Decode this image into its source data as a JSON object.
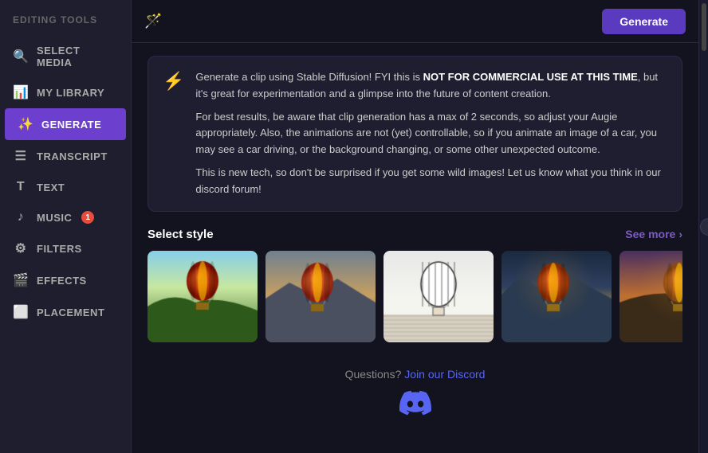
{
  "sidebar": {
    "title": "EDITING TOOLS",
    "items": [
      {
        "id": "select-media",
        "label": "SELECT MEDIA",
        "icon": "🔍",
        "active": false,
        "badge": null
      },
      {
        "id": "my-library",
        "label": "MY LIBRARY",
        "icon": "📊",
        "active": false,
        "badge": null
      },
      {
        "id": "generate",
        "label": "GENERATE",
        "icon": "✨",
        "active": true,
        "badge": null
      },
      {
        "id": "transcript",
        "label": "TRANSCRIPT",
        "icon": "☰",
        "active": false,
        "badge": null
      },
      {
        "id": "text",
        "label": "TEXT",
        "icon": "T",
        "active": false,
        "badge": null
      },
      {
        "id": "music",
        "label": "MUSIC",
        "icon": "♪",
        "active": false,
        "badge": "1"
      },
      {
        "id": "filters",
        "label": "FILTERS",
        "icon": "⚙",
        "active": false,
        "badge": null
      },
      {
        "id": "effects",
        "label": "EFFECTS",
        "icon": "🎬",
        "active": false,
        "badge": null
      },
      {
        "id": "placement",
        "label": "PLACEMENT",
        "icon": "⬜",
        "active": false,
        "badge": null
      }
    ]
  },
  "toolbar": {
    "generate_label": "Generate"
  },
  "info_box": {
    "line1_normal": "Generate a clip using Stable Diffusion! FYI this is ",
    "line1_bold": "NOT FOR COMMERCIAL USE AT THIS TIME",
    "line1_suffix": ", but it's great for experimentation and a glimpse into the future of content creation.",
    "line2": "For best results, be aware that clip generation has a max of 2 seconds, so adjust your Augie appropriately. Also, the animations are not (yet) controllable, so if you animate an image of a car, you may see a car driving, or the background changing, or some other unexpected outcome.",
    "line3": "This is new tech, so don't be surprised if you get some wild images! Let us know what you think in our discord forum!"
  },
  "style_section": {
    "title": "Select style",
    "see_more": "See more",
    "images": [
      {
        "id": "img1",
        "alt": "Hot air balloon over valley",
        "colors": [
          "#8B4513",
          "#c87941",
          "#6db33f",
          "#3a6b2a",
          "#d4a96a"
        ]
      },
      {
        "id": "img2",
        "alt": "Hot air balloon mountains sunset",
        "colors": [
          "#c87941",
          "#e8a050",
          "#8b7355",
          "#4a6080",
          "#d4c090"
        ]
      },
      {
        "id": "img3",
        "alt": "Hot air balloon sketch style",
        "colors": [
          "#f5f5f0",
          "#ddd",
          "#888",
          "#333",
          "#666"
        ]
      },
      {
        "id": "img4",
        "alt": "Hot air balloon dramatic mountains",
        "colors": [
          "#d4501a",
          "#e87030",
          "#6080a0",
          "#304060",
          "#c0a040"
        ]
      },
      {
        "id": "img5",
        "alt": "Hot air balloon dreamy",
        "colors": [
          "#d4a060",
          "#c07030",
          "#8090b0",
          "#e8c080",
          "#604020"
        ]
      }
    ]
  },
  "discord": {
    "question_text": "Questions?",
    "link_text": "Join our Discord",
    "icon": "🎮"
  }
}
